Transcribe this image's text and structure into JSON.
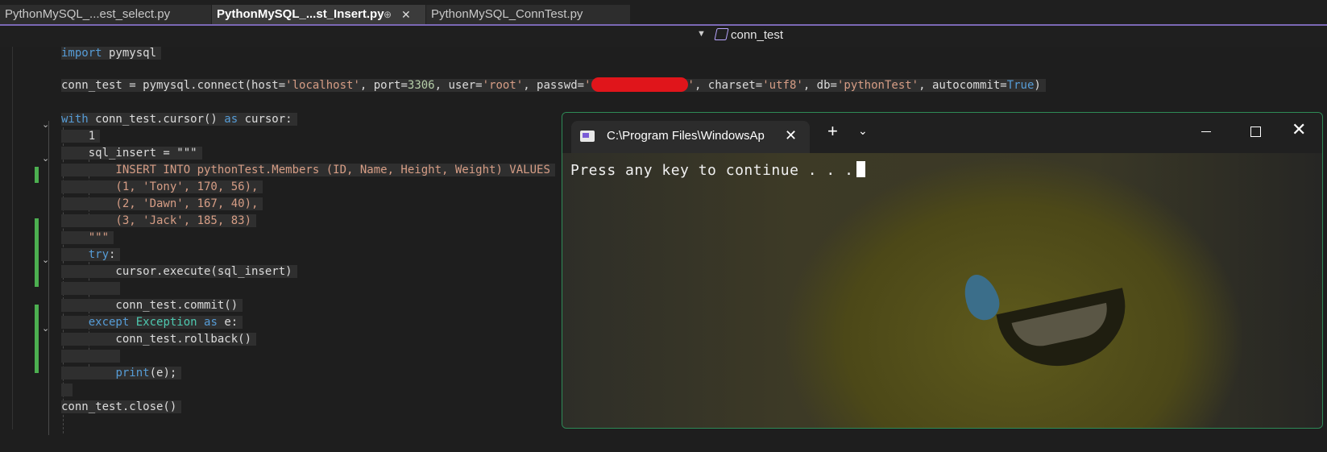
{
  "tabs": [
    {
      "label": "PythonMySQL_...est_select.py",
      "active": false
    },
    {
      "label": "PythonMySQL_...st_Insert.py",
      "active": true
    },
    {
      "label": "PythonMySQL_ConnTest.py",
      "active": false
    }
  ],
  "navbar": {
    "symbol": "conn_test"
  },
  "code": {
    "l1_import": "import",
    "l1_mod": " pymysql",
    "l3_a": "conn_test = pymysql.connect(host=",
    "l3_host": "'localhost'",
    "l3_b": ", port=",
    "l3_port": "3306",
    "l3_c": ", user=",
    "l3_user": "'root'",
    "l3_d": ", passwd=",
    "l3_pw_open": "'",
    "l3_pw_close": "'",
    "l3_e": ", charset=",
    "l3_charset": "'utf8'",
    "l3_f": ", db=",
    "l3_db": "'pythonTest'",
    "l3_g": ", autocommit=",
    "l3_true": "True",
    "l3_h": ")",
    "l5_with": "with",
    "l5_a": " conn_test.cursor() ",
    "l5_as": "as",
    "l5_b": " cursor:",
    "l6": "    1",
    "l7": "    sql_insert = \"\"\"",
    "l8": "        INSERT INTO pythonTest.Members (ID, Name, Height, Weight) VALUES",
    "l9": "        (1, 'Tony', 170, 56),",
    "l10": "        (2, 'Dawn', 167, 40),",
    "l11": "        (3, 'Jack', 185, 83)",
    "l12": "    \"\"\"",
    "l13_try": "try",
    "l13_colon": ":",
    "l14": "        cursor.execute(sql_insert)",
    "l16": "        conn_test.commit()",
    "l17_except": "except",
    "l17_exc": " Exception",
    "l17_as": " as",
    "l17_e": " e:",
    "l18": "        conn_test.rollback()",
    "l20_print": "print",
    "l20_rest": "(e);",
    "l22": "conn_test.close()"
  },
  "terminal": {
    "tab_title": "C:\\Program Files\\WindowsAp",
    "output": "Press any key to continue . . ."
  },
  "colors": {
    "accent": "#7b68b5",
    "change_bar": "#4caf50",
    "redaction": "#e0151b"
  }
}
